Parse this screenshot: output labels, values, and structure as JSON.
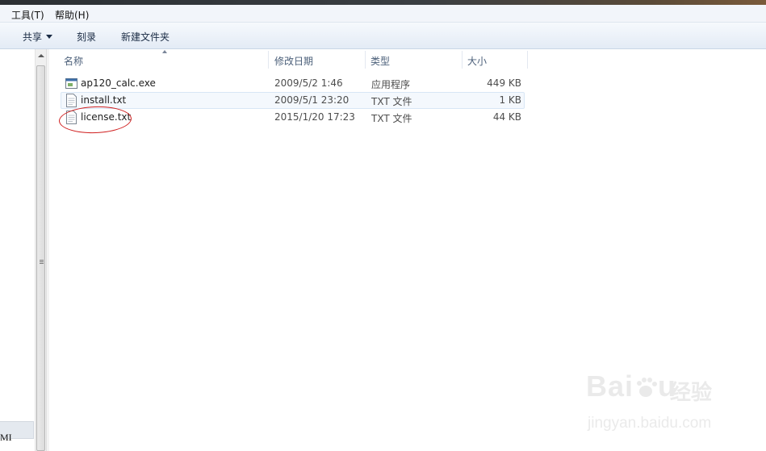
{
  "menubar": {
    "tools": "工具(T)",
    "help": "帮助(H)"
  },
  "toolbar": {
    "share": "共享",
    "burn": "刻录",
    "new_folder": "新建文件夹"
  },
  "columns": {
    "name": "名称",
    "modified": "修改日期",
    "type": "类型",
    "size": "大小"
  },
  "files": [
    {
      "name": "ap120_calc.exe",
      "modified": "2009/5/2 1:46",
      "type": "应用程序",
      "size": "449 KB",
      "icon": "exe-icon"
    },
    {
      "name": "install.txt",
      "modified": "2009/5/1 23:20",
      "type": "TXT 文件",
      "size": "1 KB",
      "icon": "text-file-icon"
    },
    {
      "name": "license.txt",
      "modified": "2015/1/20 17:23",
      "type": "TXT 文件",
      "size": "44 KB",
      "icon": "text-file-icon"
    }
  ],
  "navpane": {
    "clipped_label": "MI"
  },
  "watermark": {
    "brand": "Bai",
    "brand_end": "u",
    "cn": "经验",
    "url": "jingyan.baidu.com"
  },
  "colors": {
    "annotation": "#d02020",
    "toolbar_text": "#1a2b44",
    "header_text": "#4c607a"
  }
}
